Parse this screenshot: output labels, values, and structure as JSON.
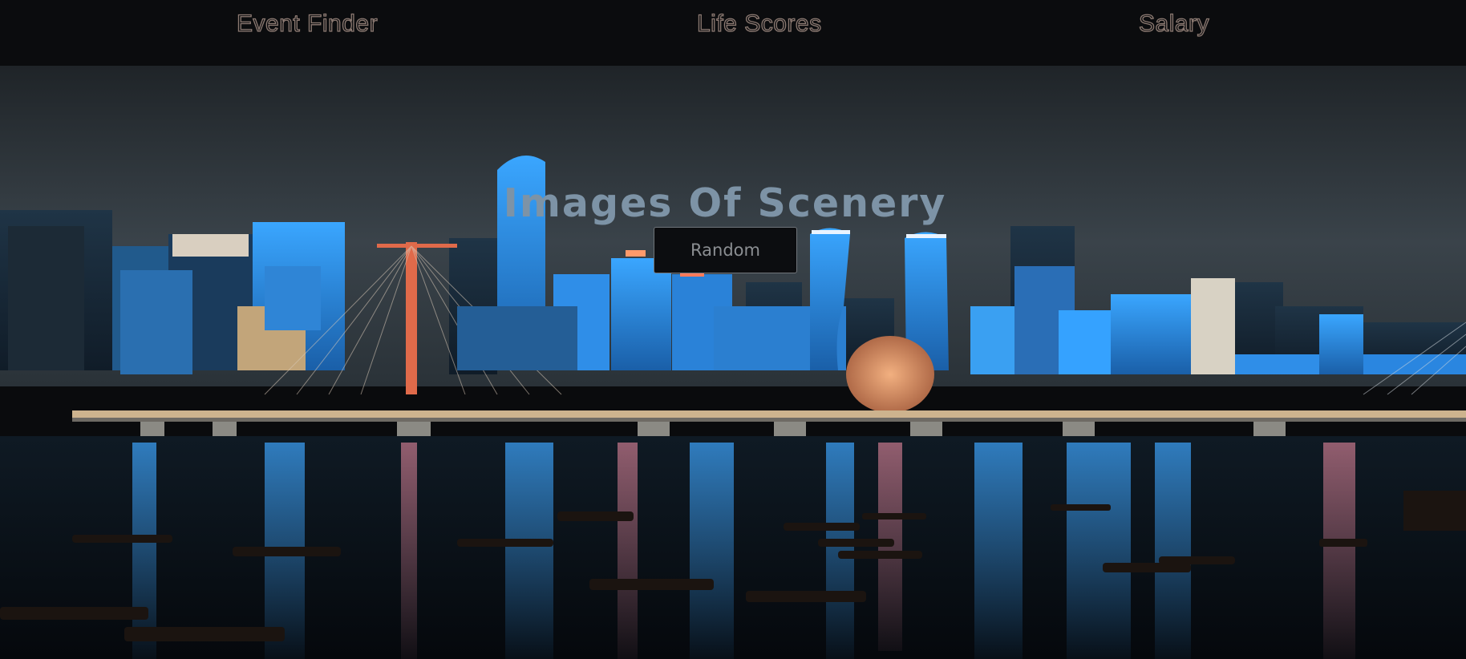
{
  "nav": {
    "items": [
      {
        "label": "Event Finder"
      },
      {
        "label": "Life Scores"
      },
      {
        "label": "Salary"
      }
    ]
  },
  "hero": {
    "title": "Images Of Scenery",
    "button_label": "Random",
    "background_image": "night-city-skyline-over-river"
  },
  "colors": {
    "nav_background": "#0b0c0e",
    "nav_text_outline": "#8c7a72",
    "title": "#7d93a6",
    "button_background": "#0c0d10",
    "button_border": "#6f7479",
    "button_text": "#8b8e92",
    "sky_top": "#22282c",
    "sky_bottom": "#3a4248",
    "city_blue": "#2e8fe0",
    "water": "#0b1118"
  }
}
